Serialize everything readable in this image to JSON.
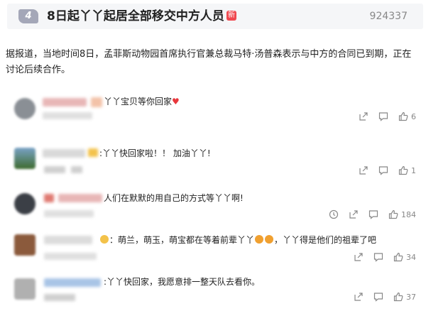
{
  "trend": {
    "rank": "4",
    "title": "8日起丫丫起居全部移交中方人员",
    "badge": "新",
    "count": "924337"
  },
  "article": {
    "text": "据报道，当地时间8日，孟菲斯动物园首席执行官兼总裁马特·汤普森表示与中方的合同已到期，正在讨论后续合作。"
  },
  "comments": [
    {
      "text": "丫丫宝贝等你回家",
      "likes": "6"
    },
    {
      "text": ":丫丫快回家啦！！ 加油丫丫!",
      "likes": "1"
    },
    {
      "text": "人们在默默的用自己的方式等丫丫啊!",
      "likes": "184"
    },
    {
      "text": "：萌兰，萌玉，萌宝都在等着前辈丫丫",
      "text_b": "，丫丫得是他们的祖辈了吧",
      "likes": "34"
    },
    {
      "text": ":丫丫快回家，我愿意排一整天队去看你。",
      "likes": "37"
    }
  ],
  "icons": {
    "like": "thumbs-up-icon",
    "comment": "comment-icon",
    "share": "share-icon",
    "repost": "repost-icon"
  },
  "colors": {
    "rank_badge": "#a4a7b8",
    "new_badge": "#f0484f",
    "heart": "#e8363b",
    "muted": "#888888"
  }
}
